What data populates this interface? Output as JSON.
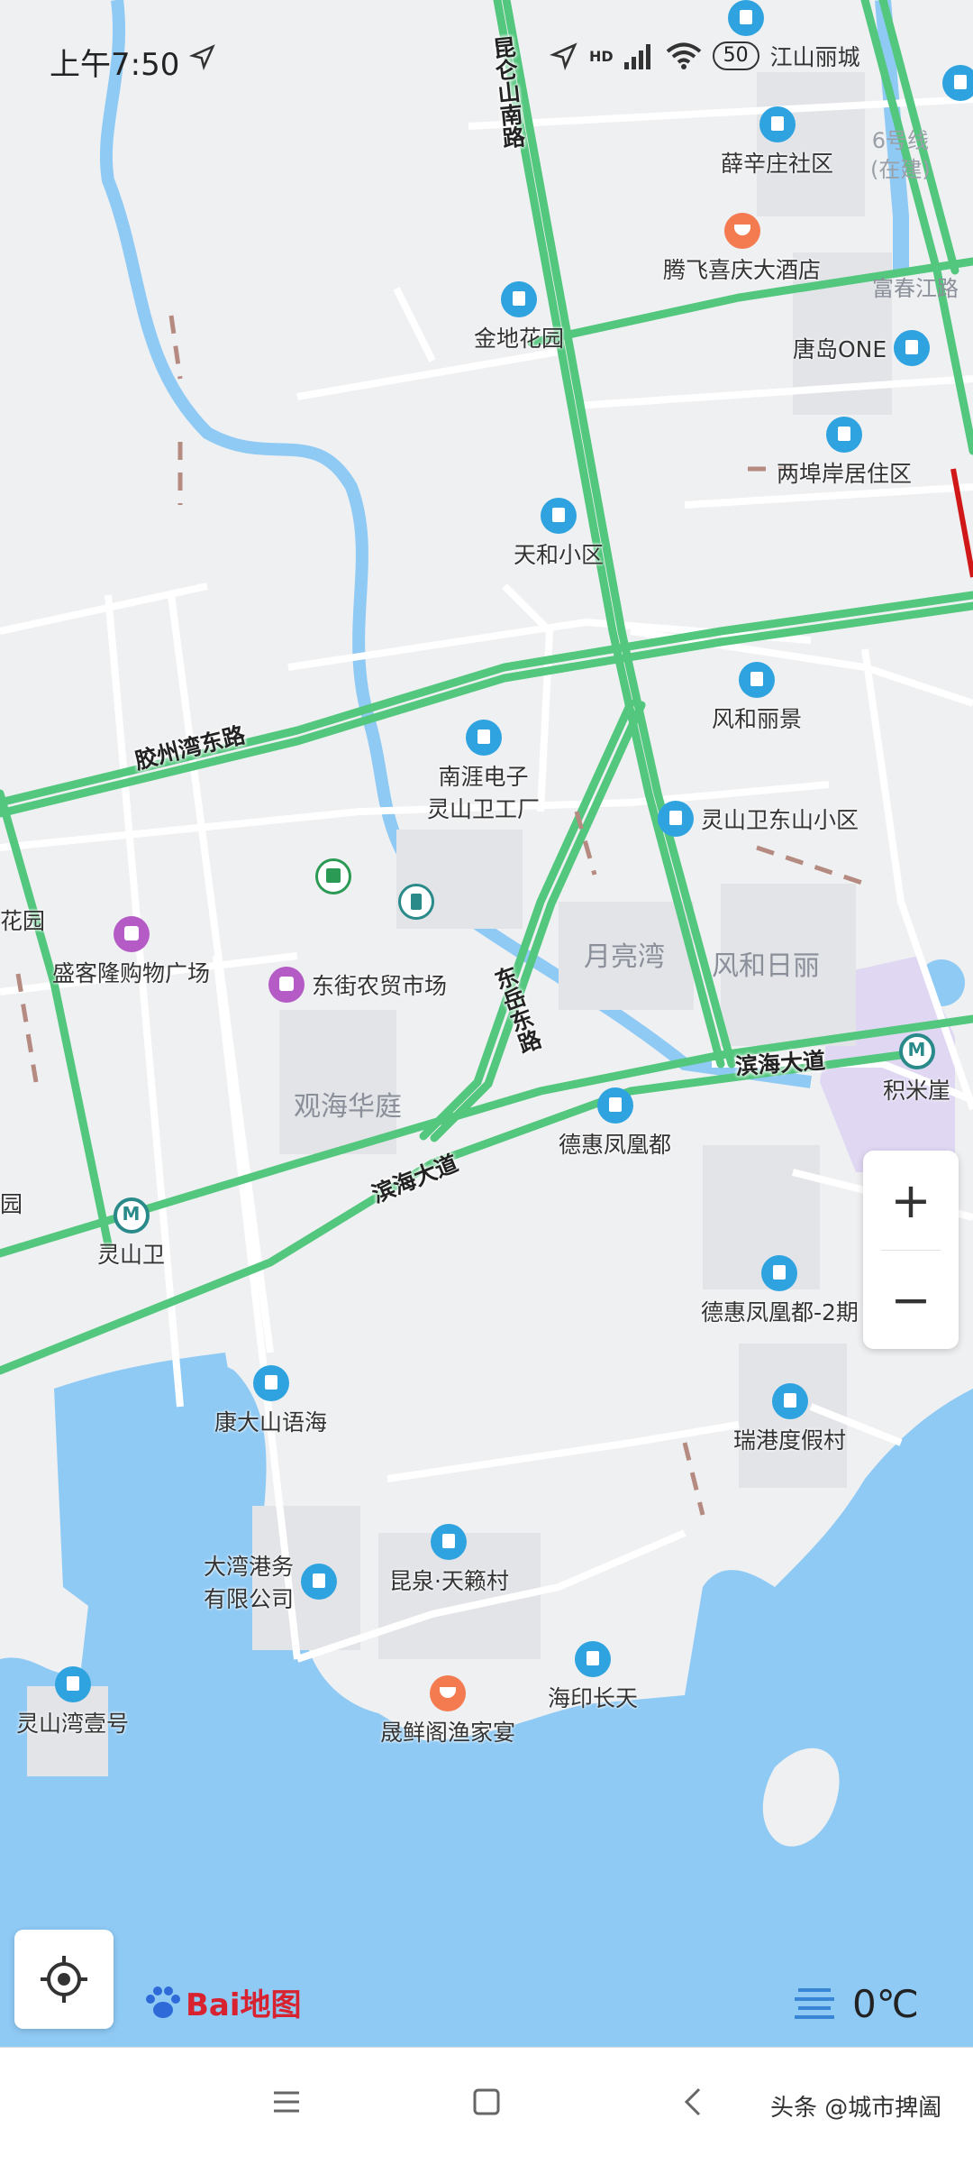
{
  "status_bar": {
    "time": "上午7:50",
    "network": "HD",
    "battery": "50"
  },
  "roads": {
    "kunlunshan_nan": "昆仑山南路",
    "jiaozhouwan_dong": "胶州湾东路",
    "dongyue_dong": "东岳东路",
    "binhai_upper": "滨海大道",
    "binhai_lower": "滨海大道",
    "fuchunjiang": "富春江路"
  },
  "pois": {
    "jiangshan_licheng": "江山丽城",
    "xuexinzhuang": "薛辛庄社区",
    "tengfei_hotel": "腾飞喜庆大酒店",
    "jindi_huayuan": "金地花园",
    "tangdao_one": "唐岛ONE",
    "liangfuan": "两埠岸居住区",
    "tianhe": "天和小区",
    "fenghe_lijing": "风和丽景",
    "nanya": "南涯电子\n灵山卫工厂",
    "lingshanwei_dongshan": "灵山卫东山小区",
    "shengke_mall": "盛客隆购物广场",
    "dongjie_market": "东街农贸市场",
    "dehui_fenghuangdu": "德惠凤凰都",
    "dehui_fenghuangdu2": "德惠凤凰都-2期",
    "kangda_shanyuhai": "康大山语海",
    "ruigang": "瑞港度假村",
    "dawan_port": "大湾港务\n有限公司",
    "kunquan": "昆泉·天籁村",
    "lingshanwan_one": "灵山湾壹号",
    "shengxian": "晟鲜阁渔家宴",
    "haiyin": "海印长天",
    "huayuan_left": "花园",
    "garden_left2": "园"
  },
  "metro": {
    "lingshanwei": "灵山卫",
    "jimiya": "积米崖",
    "line6": "6号线\n(在建)"
  },
  "areas": {
    "yueliangwan": "月亮湾",
    "fenghe_rili": "风和日丽",
    "guanhai": "观海华庭"
  },
  "controls": {
    "zoom_in": "+",
    "zoom_out": "−",
    "temperature": "0℃",
    "brand": "Bai地图"
  },
  "nav": {
    "watermark": "头条 @城市捭阖"
  },
  "colors": {
    "water": "#8fcaf5",
    "land": "#eff0f2",
    "road_green": "#52c77d",
    "road_red": "#d01818",
    "poi_blue": "#2fa3e0",
    "poi_food": "#f37b4f",
    "poi_shop": "#b45bc6"
  }
}
